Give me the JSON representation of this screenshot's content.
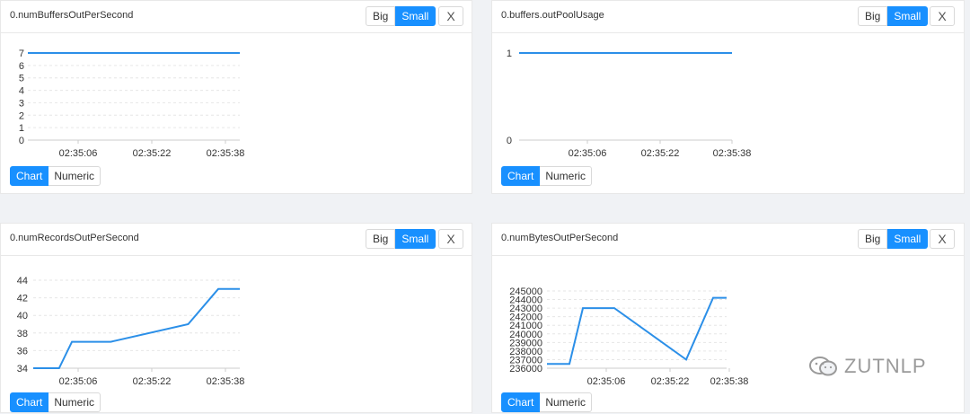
{
  "size_labels": {
    "big": "Big",
    "small": "Small"
  },
  "view_labels": {
    "chart": "Chart",
    "numeric": "Numeric"
  },
  "close_symbol": "X",
  "accent_color": "#1890ff",
  "line_color": "#2b8fe8",
  "panels": [
    {
      "title": "0.numBuffersOutPerSecond"
    },
    {
      "title": "0.buffers.outPoolUsage"
    },
    {
      "title": "0.numRecordsOutPerSecond"
    },
    {
      "title": "0.numBytesOutPerSecond"
    }
  ],
  "watermark": {
    "text": "ZUTNLP",
    "icon": "wechat-icon"
  },
  "chart_data": [
    {
      "type": "line",
      "title": "0.numBuffersOutPerSecond",
      "x_ticks": [
        "02:35:06",
        "02:35:22",
        "02:35:38"
      ],
      "y_ticks": [
        "0",
        "1",
        "2",
        "3",
        "4",
        "5",
        "6",
        "7"
      ],
      "ylim": [
        0,
        7
      ],
      "grid": true,
      "series": [
        {
          "x": [
            0,
            1,
            2,
            3,
            4,
            5,
            6,
            7,
            8,
            9,
            10,
            11,
            12,
            13,
            14,
            15,
            16,
            17,
            18,
            19,
            20,
            21,
            22,
            23,
            24
          ],
          "values": [
            7,
            7,
            7,
            7,
            7,
            7,
            7,
            7,
            7,
            7,
            7,
            7,
            7,
            7,
            7,
            7,
            7,
            7,
            7,
            7,
            7,
            7,
            7,
            7,
            7
          ]
        }
      ]
    },
    {
      "type": "line",
      "title": "0.buffers.outPoolUsage",
      "x_ticks": [
        "02:35:06",
        "02:35:22",
        "02:35:38"
      ],
      "y_ticks": [
        "0",
        "1"
      ],
      "ylim": [
        0,
        1
      ],
      "grid": false,
      "series": [
        {
          "x": [
            0,
            4,
            8,
            12,
            16,
            20,
            24
          ],
          "values": [
            1,
            1,
            1,
            1,
            1,
            1,
            1
          ]
        }
      ]
    },
    {
      "type": "line",
      "title": "0.numRecordsOutPerSecond",
      "x_ticks": [
        "02:35:06",
        "02:35:22",
        "02:35:38"
      ],
      "y_ticks": [
        "34",
        "36",
        "38",
        "40",
        "42",
        "44"
      ],
      "ylim": [
        34,
        44
      ],
      "grid": true,
      "series": [
        {
          "x": [
            0,
            3,
            4.5,
            9,
            18,
            21.5,
            23,
            24
          ],
          "values": [
            34,
            34,
            37,
            37,
            39,
            43,
            43,
            43
          ]
        }
      ]
    },
    {
      "type": "line",
      "title": "0.numBytesOutPerSecond",
      "x_ticks": [
        "02:35:06",
        "02:35:22",
        "02:35:38"
      ],
      "y_ticks": [
        "236000",
        "237000",
        "238000",
        "239000",
        "240000",
        "241000",
        "242000",
        "243000",
        "244000",
        "245000"
      ],
      "ylim": [
        236000,
        245000
      ],
      "grid": true,
      "series": [
        {
          "x": [
            0,
            2.5,
            4,
            7.5,
            15.5,
            18.5,
            20
          ],
          "values": [
            236500,
            236500,
            243000,
            243000,
            237000,
            244200,
            244200
          ]
        }
      ]
    }
  ]
}
